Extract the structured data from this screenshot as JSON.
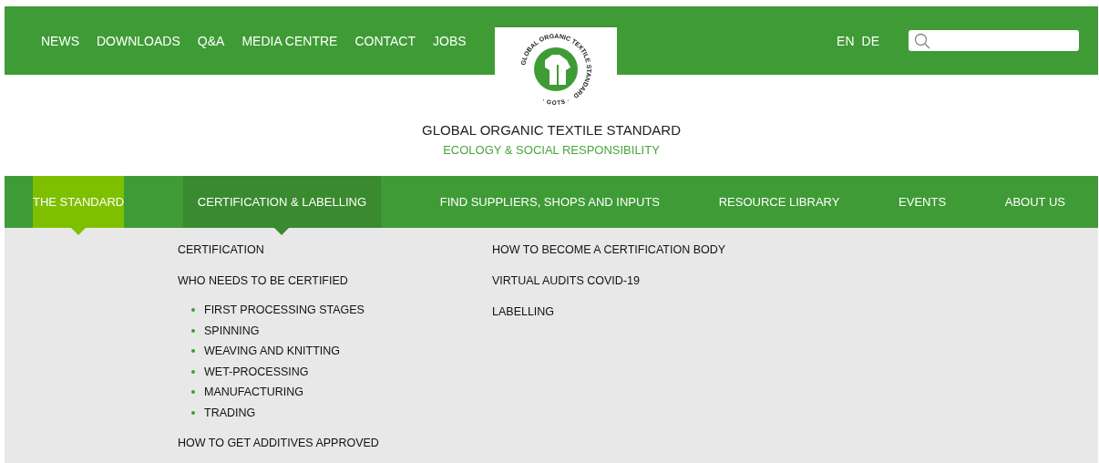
{
  "top_links": [
    {
      "label": "NEWS"
    },
    {
      "label": "DOWNLOADS"
    },
    {
      "label": "Q&A"
    },
    {
      "label": "MEDIA CENTRE"
    },
    {
      "label": "CONTACT"
    },
    {
      "label": "JOBS"
    }
  ],
  "logo": {
    "ring_text": "GLOBAL ORGANIC TEXTILE STANDARD",
    "bottom_text": "· GOTS ·"
  },
  "languages": [
    {
      "label": "EN"
    },
    {
      "label": "DE"
    }
  ],
  "site_title": "GLOBAL ORGANIC TEXTILE STANDARD",
  "site_subtitle": "ECOLOGY & SOCIAL RESPONSIBILITY",
  "main_nav": [
    {
      "label": "THE STANDARD",
      "selected": true,
      "expanded": false
    },
    {
      "label": "CERTIFICATION & LABELLING",
      "selected": false,
      "expanded": true
    },
    {
      "label": "FIND SUPPLIERS, SHOPS AND INPUTS",
      "selected": false,
      "expanded": false
    },
    {
      "label": "RESOURCE LIBRARY",
      "selected": false,
      "expanded": false
    },
    {
      "label": "EVENTS",
      "selected": false,
      "expanded": false
    },
    {
      "label": "ABOUT US",
      "selected": false,
      "expanded": false
    }
  ],
  "dropdown": {
    "columns": [
      [
        {
          "label": "CERTIFICATION"
        },
        {
          "label": "WHO NEEDS TO BE CERTIFIED",
          "children": [
            {
              "label": "FIRST PROCESSING STAGES"
            },
            {
              "label": "SPINNING"
            },
            {
              "label": "WEAVING AND KNITTING"
            },
            {
              "label": "WET-PROCESSING"
            },
            {
              "label": "MANUFACTURING"
            },
            {
              "label": "TRADING"
            }
          ]
        },
        {
          "label": "HOW TO GET ADDITIVES APPROVED"
        }
      ],
      [
        {
          "label": "HOW TO BECOME A CERTIFICATION BODY"
        },
        {
          "label": "VIRTUAL AUDITS COVID-19"
        },
        {
          "label": "LABELLING"
        }
      ]
    ]
  }
}
